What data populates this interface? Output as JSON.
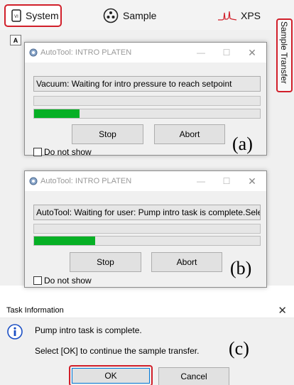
{
  "tabs": {
    "system": "System",
    "sample": "Sample",
    "xps": "XPS"
  },
  "side_tab": "Sample Transfer",
  "dialog_a": {
    "title": "AutoTool: INTRO PLATEN",
    "message": "Vacuum: Waiting for intro pressure to reach setpoint",
    "progress": 0.2,
    "stop": "Stop",
    "abort": "Abort",
    "checkbox": "Do not show",
    "marker": "(a)"
  },
  "dialog_b": {
    "title": "AutoTool: INTRO PLATEN",
    "message": "AutoTool: Waiting for user: Pump intro task is complete.Selec",
    "progress": 0.27,
    "stop": "Stop",
    "abort": "Abort",
    "checkbox": "Do not show",
    "marker": "(b)"
  },
  "task_dialog": {
    "title": "Task Information",
    "line1": "Pump intro task is complete.",
    "line2": "Select [OK] to continue the sample transfer.",
    "ok": "OK",
    "cancel": "Cancel",
    "marker": "(c)"
  },
  "icons": {
    "system": "monitor-icon",
    "sample": "sample-holder-icon",
    "xps": "spectrum-icon",
    "app": "gear-app-icon",
    "info": "info-icon"
  },
  "colors": {
    "highlight": "#d11f2a",
    "progress": "#06b025",
    "info_blue": "#1b4fc4"
  }
}
